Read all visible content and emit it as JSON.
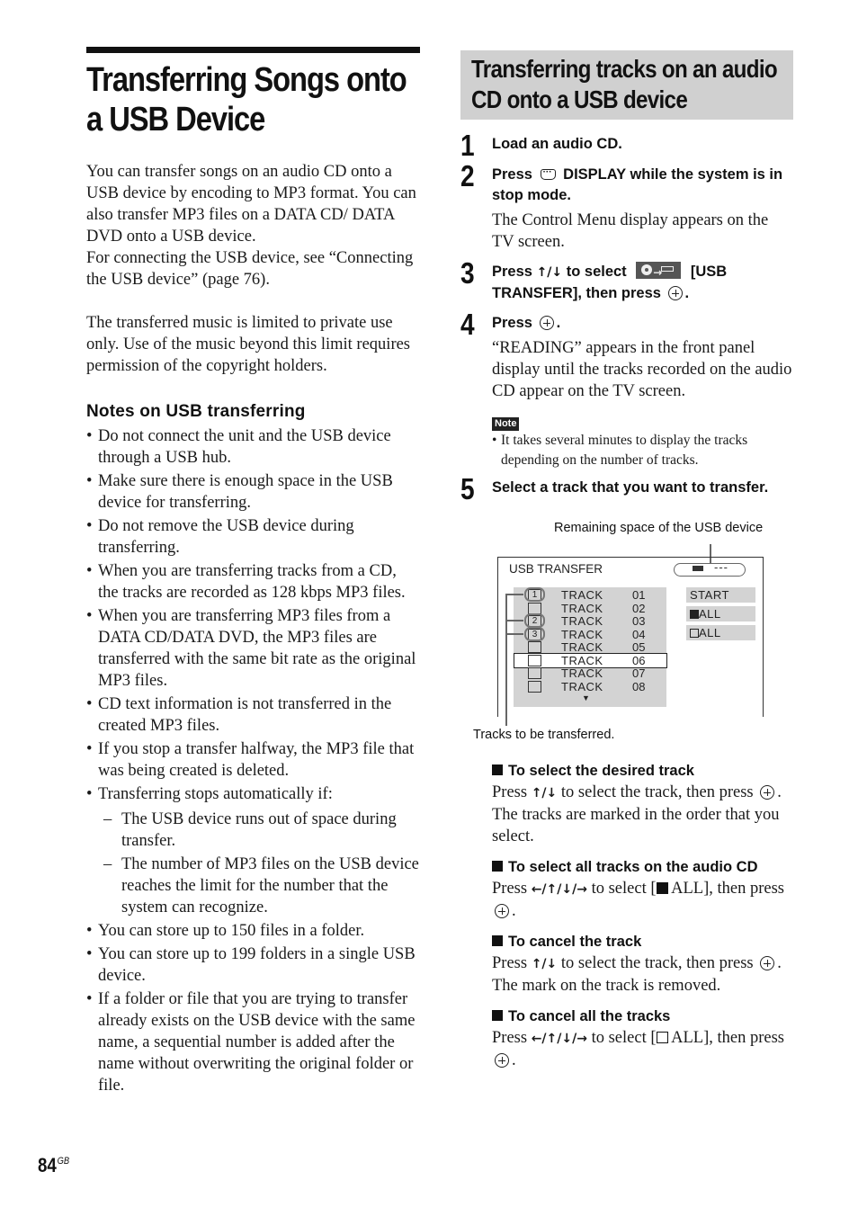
{
  "page": {
    "number": "84",
    "region_suffix": "GB"
  },
  "left": {
    "title": "Transferring Songs onto a USB Device",
    "intro_paragraphs": [
      "You can transfer songs on an audio CD onto a USB device by encoding to MP3 format. You can also transfer MP3 files on a DATA CD/ DATA DVD onto a USB device.",
      "For connecting the USB device, see “Connecting the USB device” (page 76).",
      "The transferred music is limited to private use only. Use of the music beyond this limit requires permission of the copyright holders."
    ],
    "notes_heading": "Notes on USB transferring",
    "notes": [
      "Do not connect the unit and the USB device through a USB hub.",
      "Make sure there is enough space in the USB device for transferring.",
      "Do not remove the USB device during transferring.",
      "When you are transferring tracks from a CD, the tracks are recorded as 128 kbps MP3 files.",
      "When you are transferring MP3 files from a DATA CD/DATA DVD, the MP3 files are transferred with the same bit rate as the original MP3 files.",
      "CD text information is not transferred in the created MP3 files.",
      "If you stop a transfer halfway, the MP3 file that was being created is deleted.",
      "Transferring stops automatically if:",
      "You can store up to 150 files in a folder.",
      "You can store up to 199 folders in a single USB device.",
      "If a folder or file that you are trying to transfer already exists on the USB device with the same name, a sequential number is added after the name without overwriting the original folder or file."
    ],
    "stop_conditions": [
      "The USB device runs out of space during transfer.",
      "The number of MP3 files on the USB device reaches the limit for the number that the system can recognize."
    ]
  },
  "right": {
    "section_title": "Transferring tracks on an audio CD onto a USB device",
    "steps": [
      {
        "num": "1",
        "title": "Load an audio CD."
      },
      {
        "num": "2",
        "title_pre": "Press",
        "title_post": "DISPLAY while the system is in stop mode.",
        "body": "The Control Menu display appears on the TV screen."
      },
      {
        "num": "3",
        "title_pre": "Press",
        "arrows": "↑/↓",
        "title_mid": "to select",
        "title_post": "[USB TRANSFER], then press",
        "period": "."
      },
      {
        "num": "4",
        "title_pre": "Press",
        "period": ".",
        "body": "“READING” appears in the front panel display until the tracks recorded on the audio CD appear on the TV screen."
      },
      {
        "num": "5",
        "title": "Select a track that you want to transfer."
      }
    ],
    "note_label": "Note",
    "note_text": "It takes several minutes to display the tracks depending on the number of tracks."
  },
  "diagram": {
    "callout_top": "Remaining space of the USB device",
    "callout_bottom": "Tracks to be transferred.",
    "screen_title": "USB TRANSFER",
    "remaining_space": "---",
    "tracks": [
      {
        "label": "TRACK",
        "num": "01",
        "mark": "1"
      },
      {
        "label": "TRACK",
        "num": "02",
        "mark": ""
      },
      {
        "label": "TRACK",
        "num": "03",
        "mark": "2"
      },
      {
        "label": "TRACK",
        "num": "04",
        "mark": "3"
      },
      {
        "label": "TRACK",
        "num": "05",
        "mark": ""
      },
      {
        "label": "TRACK",
        "num": "06",
        "mark": ""
      },
      {
        "label": "TRACK",
        "num": "07",
        "mark": ""
      },
      {
        "label": "TRACK",
        "num": "08",
        "mark": ""
      }
    ],
    "selected_track": "06",
    "buttons": [
      "START",
      "ALL",
      "ALL"
    ]
  },
  "subsections": [
    {
      "heading": "To select the desired track",
      "pre": "Press",
      "arrows": "↑/↓",
      "mid": "to select the track, then press",
      "post": ".",
      "extra": "The tracks are marked in the order that you select."
    },
    {
      "heading": "To select all tracks on the audio CD",
      "pre": "Press",
      "arrows": "←/↑/↓/→",
      "mid": "to select [",
      "bracket": "ALL], then press",
      "post": "."
    },
    {
      "heading": "To cancel the track",
      "pre": "Press",
      "arrows": "↑/↓",
      "mid": "to select the track, then press",
      "post": ".",
      "extra": "The mark on the track is removed."
    },
    {
      "heading": "To cancel all the tracks",
      "pre": "Press",
      "arrows": "←/↑/↓/→",
      "mid": "to select [",
      "bracket": "ALL], then press",
      "post": "."
    }
  ]
}
